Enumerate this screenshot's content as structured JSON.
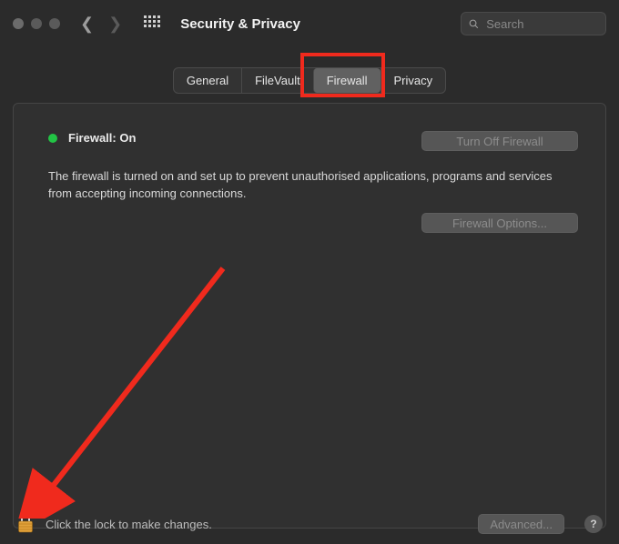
{
  "window": {
    "title": "Security & Privacy"
  },
  "search": {
    "placeholder": "Search"
  },
  "tabs": {
    "general": "General",
    "filevault": "FileVault",
    "firewall": "Firewall",
    "privacy": "Privacy"
  },
  "firewall": {
    "status_label": "Firewall: On",
    "status_color": "#22c445",
    "turn_off_label": "Turn Off Firewall",
    "description": "The firewall is turned on and set up to prevent unauthorised applications, programs and services from accepting incoming connections.",
    "options_label": "Firewall Options..."
  },
  "footer": {
    "lock_text": "Click the lock to make changes.",
    "advanced_label": "Advanced...",
    "help_label": "?"
  },
  "annotation": {
    "highlight_color": "#f02a1d"
  }
}
